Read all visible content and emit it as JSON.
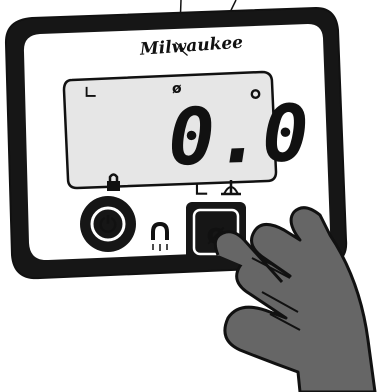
{
  "device": {
    "brand": "Milwaukee",
    "display": {
      "reading": "0.0",
      "unit": "°",
      "level_indicator": "∟",
      "null_indicator": "ø"
    },
    "buttons": {
      "power_symbol": "⏻",
      "zero_symbol": "ø",
      "zero_mode_icons": [
        "∟",
        "⊥"
      ],
      "lock_icon": "lock-icon",
      "magnet_icon": "magnet-icon"
    }
  }
}
